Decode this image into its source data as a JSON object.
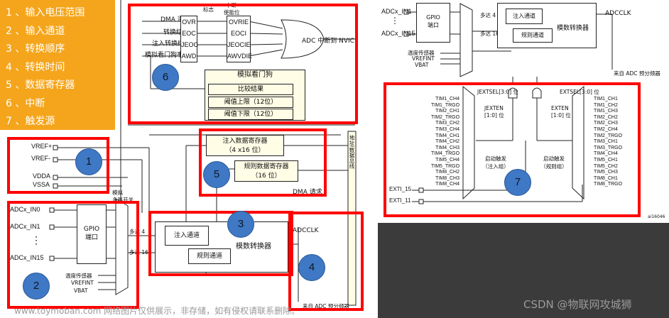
{
  "legend": [
    "1 、输入电压范围",
    "2 、输入通道",
    "3 、转换顺序",
    "4 、转换时间",
    "5 、数据寄存器",
    "6 、中断",
    "7 、触发源"
  ],
  "badges": [
    "1",
    "2",
    "3",
    "4",
    "5",
    "6",
    "7"
  ],
  "colors": {
    "legend_bg": "#f5a51b",
    "zone_border": "#ff0000",
    "badge_fill": "#3f78c4",
    "box_fill": "#fffde6"
  },
  "interrupt": {
    "top_labels": [
      "标志",
      "中断",
      "使能位"
    ],
    "dma_overrun": "DMA 溢出",
    "flag_sources": [
      "转换结束",
      "注入转换结束",
      "模拟看门狗事件"
    ],
    "flags": [
      "OVR",
      "EOC",
      "JEOC",
      "AWD"
    ],
    "enables": [
      "OVRIE",
      "EOCI",
      "JEOCIE",
      "AWVDIE"
    ],
    "output": "ADC 中断到 NVIC"
  },
  "watchdog": {
    "title": "模拟看门狗",
    "rows": [
      "比较结果",
      "阈值上限（12位）",
      "阈值下限（12位）"
    ]
  },
  "voltage_pins": [
    "VREF+",
    "VREF-",
    "VDDA",
    "VSSA"
  ],
  "data_registers": {
    "injected": "注入数据寄存器",
    "injected_size": "（4 x16 位）",
    "regular": "规则数据寄存器",
    "regular_size": "（16 位）",
    "dma_request": "DMA 请求",
    "bus": "地址/数据总线"
  },
  "inputs": {
    "channels": [
      "ADCx_IN0",
      "ADCx_IN1",
      "⋮",
      "ADCx_IN15"
    ],
    "gpio": [
      "GPIO",
      "端口"
    ],
    "analog_mux": [
      "模拟",
      "多路开关"
    ],
    "up_to_4": "多达 4",
    "up_to_16": "多达 16",
    "internal": [
      "温度传感器",
      "VREFINT",
      "VBAT"
    ]
  },
  "converter": {
    "injected": "注入通道",
    "regular": "规则通道",
    "title": "模数转换器"
  },
  "clock": {
    "adcclk": "ADCCLK",
    "prescaler": "来自 ADC 预分频器"
  },
  "triggers": {
    "jextsel": "JEXTSEL[3:0] 位",
    "extsel": "EXTSEL[3:0] 位",
    "jexten": "JEXTEN",
    "jexten_bits": "[1:0] 位",
    "exten": "EXTEN",
    "exten_bits": "[1:0] 位",
    "injected_label": "启动触发（注入组）",
    "regular_label": "启动触发（规则组）",
    "injected_sources": [
      "TIM1_CH4",
      "TIM1_TRGO",
      "TIM2_CH1",
      "TIM2_TRGO",
      "TIM3_CH2",
      "TIM3_CH4",
      "TIM4_CH1",
      "TIM4_CH2",
      "TIM4_CH3",
      "TIM4_TRGO",
      "TIM5_CH4",
      "TIM5_TRGO",
      "TIM8_CH2",
      "TIM8_CH3",
      "TIM8_CH4"
    ],
    "regular_sources": [
      "TIM1_CH1",
      "TIM1_CH2",
      "TIM1_CH3",
      "TIM2_CH2",
      "TIM2_CH3",
      "TIM2_CH4",
      "TIM2_TRGO",
      "TIM3_CH1",
      "TIM3_TRGO",
      "TIM4_CH4",
      "TIM5_CH1",
      "TIM5_CH2",
      "TIM5_CH3",
      "TIM8_CH1",
      "TIM8_TRGO"
    ],
    "exti_15": "EXTI_15",
    "exti_11": "EXTI_11",
    "figure_id": "ai16046"
  },
  "overview_top": {
    "adcx_in1": "ADCx_IN1",
    "adcx_in15": "ADCx_IN15",
    "dots": "⋮",
    "gpio": [
      "GPIO",
      "端口"
    ],
    "up_to_4": "多达 4",
    "up_to_16": "多达 16",
    "internal": [
      "温度传感器",
      "VREFINT",
      "VBAT"
    ],
    "injected": "注入通道",
    "regular": "规则通道",
    "converter": "模数转换器",
    "adcclk": "ADCCLK",
    "prescaler": "来自 ADC 预分频器"
  },
  "watermark": "www.toymoban.com 网络图片仅供展示，非存储，如有侵权请联系删除。",
  "credit": "CSDN @物联网攻城狮"
}
